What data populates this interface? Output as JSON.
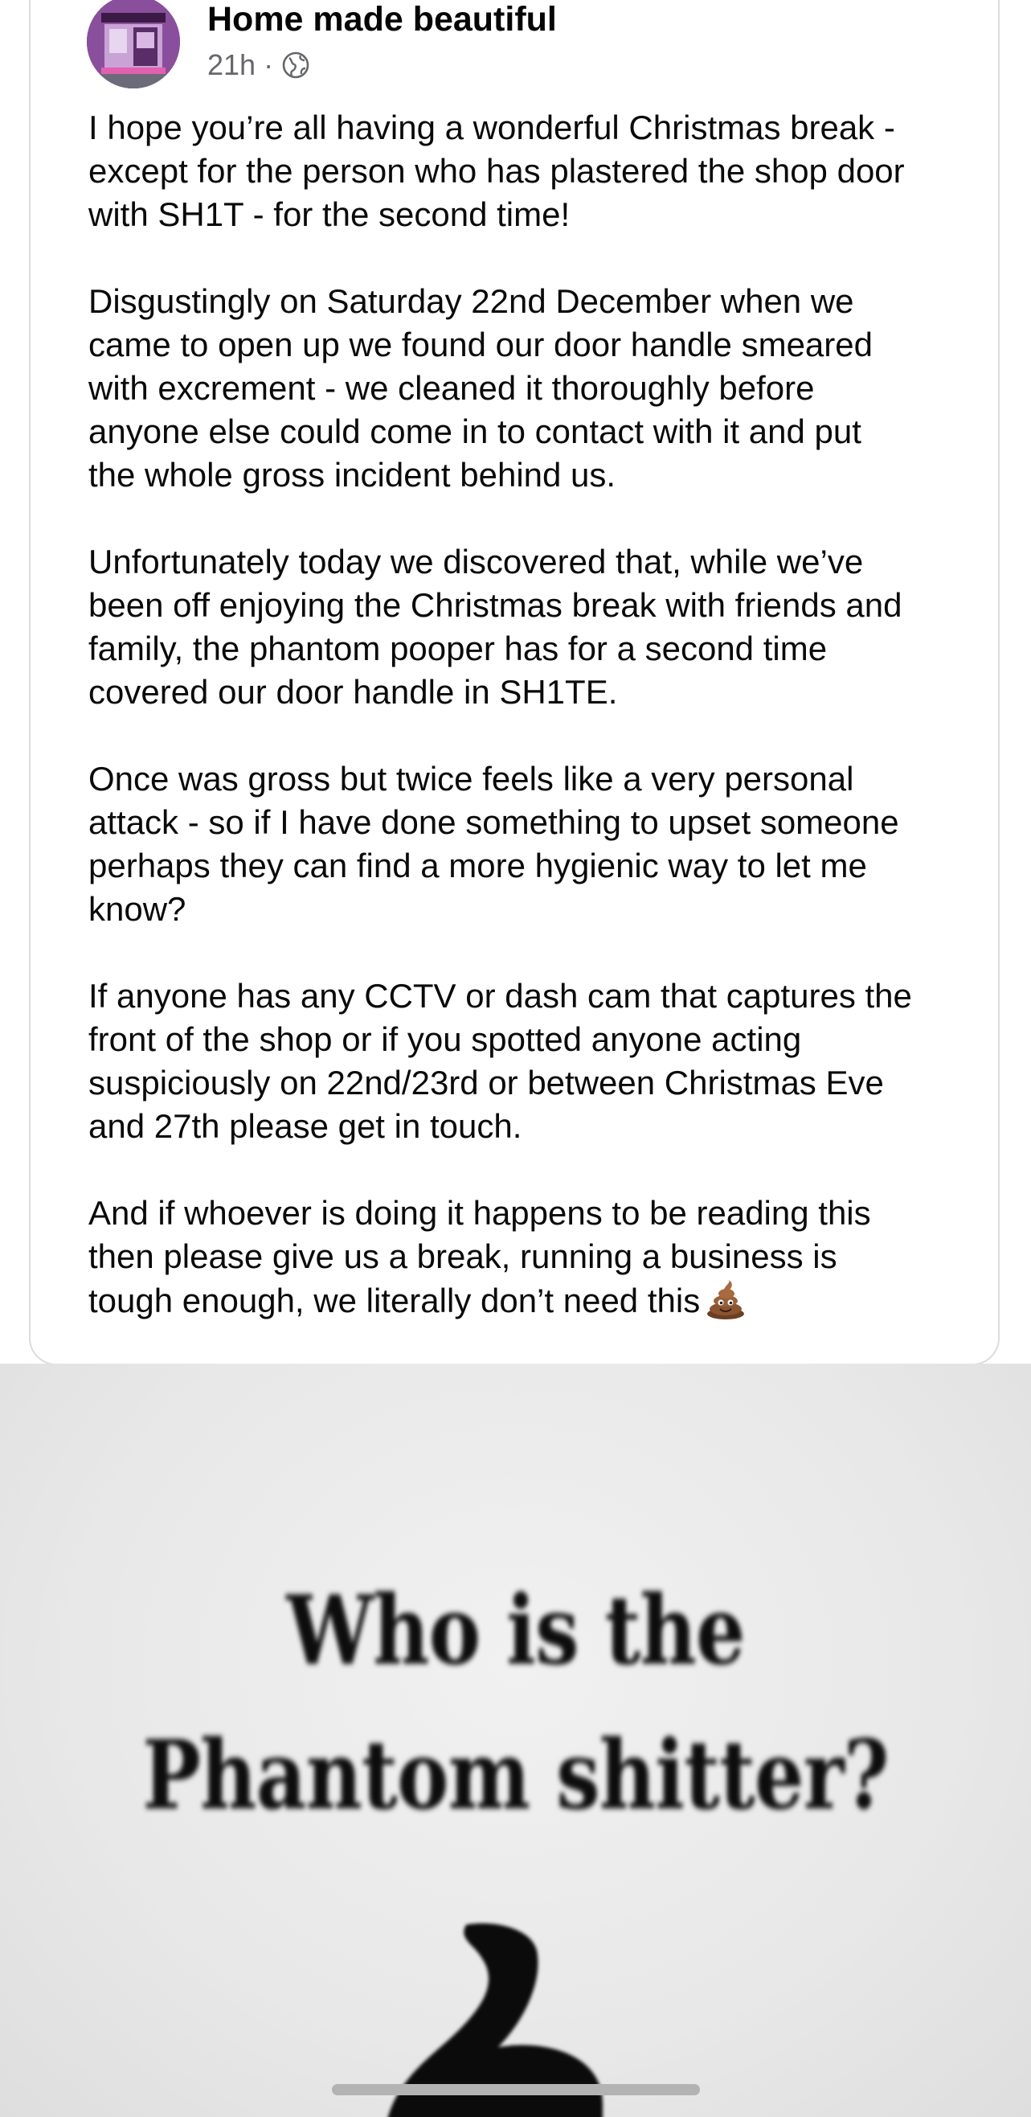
{
  "post": {
    "page_name": "Home made beautiful",
    "timestamp": "21h",
    "separator": "·",
    "audience_icon": "globe-icon",
    "paragraphs": [
      [
        "I hope you’re all having a wonderful Christmas break -",
        "except for the person who has plastered the shop door",
        "with SH1T - for the second time!"
      ],
      [
        "Disgustingly on Saturday 22nd December when we",
        "came to open up we found our door handle smeared",
        "with excrement - we cleaned it thoroughly before",
        "anyone else could come in to contact with it and put",
        "the whole gross incident behind us."
      ],
      [
        "Unfortunately today we discovered that, while we’ve",
        "been off enjoying the Christmas break with friends and",
        "family, the phantom pooper has for a second time",
        "covered our door handle in SH1TE."
      ],
      [
        "Once was gross but twice feels like a very personal",
        "attack - so if I have done something to upset someone",
        "perhaps they can find a more hygienic way to let me",
        "know?"
      ],
      [
        "If anyone has any CCTV or dash cam that captures the",
        "front of the shop or if you spotted anyone acting",
        "suspiciously on 22nd/23rd or between Christmas Eve",
        "and 27th please get in touch."
      ],
      [
        "And if whoever is doing it happens to be reading this",
        "then please give us a break, running a business is",
        "tough enough, we literally don’t need this"
      ]
    ],
    "closing_emoji": "poop-emoji"
  },
  "meme": {
    "line1": "Who is the",
    "line2": "Phantom shitter?",
    "graphic": "poop-icon"
  },
  "colors": {
    "avatar_purple": "#7c3f8c",
    "meta_grey": "#65676b",
    "text": "#050505"
  }
}
